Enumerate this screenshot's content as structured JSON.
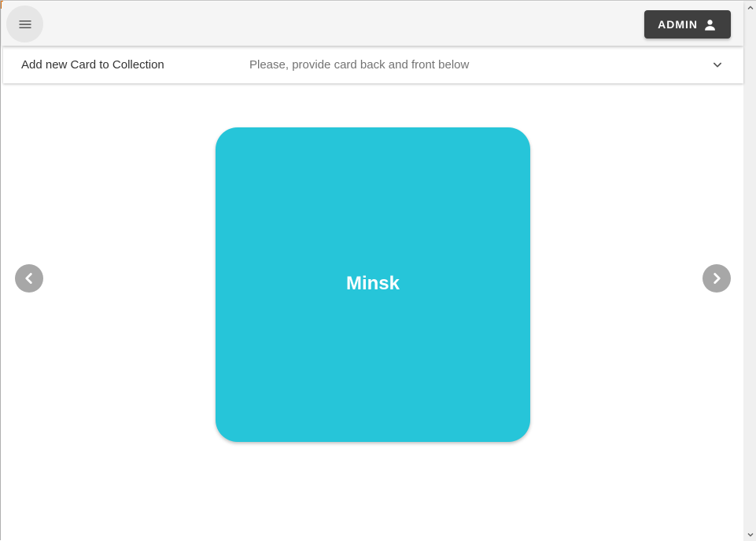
{
  "header": {
    "admin_label": "ADMIN"
  },
  "panel": {
    "title": "Add new Card to Collection",
    "description": "Please, provide card back and front below",
    "expanded": false
  },
  "carousel": {
    "current_card_text": "Minsk"
  },
  "colors": {
    "card": "#26c5d9",
    "appbar": "#f5f5f5",
    "admin_button": "#3f3f3f",
    "nav_button": "#a7a7a7"
  },
  "icons": {
    "menu": "menu-icon",
    "user": "person-icon",
    "expand": "chevron-down-icon",
    "prev": "chevron-left-icon",
    "next": "chevron-right-icon"
  }
}
